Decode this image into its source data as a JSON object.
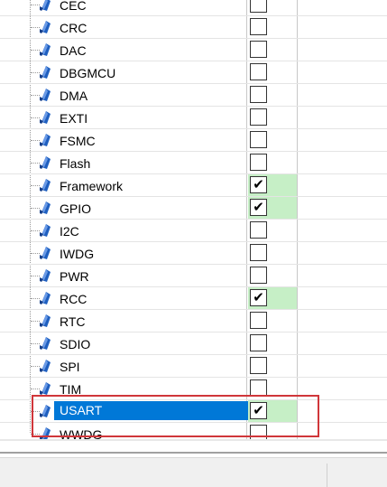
{
  "tree": {
    "items": [
      {
        "label": "CEC",
        "checked": false
      },
      {
        "label": "CRC",
        "checked": false
      },
      {
        "label": "DAC",
        "checked": false
      },
      {
        "label": "DBGMCU",
        "checked": false
      },
      {
        "label": "DMA",
        "checked": false
      },
      {
        "label": "EXTI",
        "checked": false
      },
      {
        "label": "FSMC",
        "checked": false
      },
      {
        "label": "Flash",
        "checked": false
      },
      {
        "label": "Framework",
        "checked": true
      },
      {
        "label": "GPIO",
        "checked": true
      },
      {
        "label": "I2C",
        "checked": false
      },
      {
        "label": "IWDG",
        "checked": false
      },
      {
        "label": "PWR",
        "checked": false
      },
      {
        "label": "RCC",
        "checked": true
      },
      {
        "label": "RTC",
        "checked": false
      },
      {
        "label": "SDIO",
        "checked": false
      },
      {
        "label": "SPI",
        "checked": false
      },
      {
        "label": "TIM",
        "checked": false
      },
      {
        "label": "USART",
        "checked": true,
        "selected": true
      },
      {
        "label": "WWDG",
        "checked": false
      }
    ],
    "check_mark": "✔",
    "item_icon": "blue-gem-icon"
  },
  "colors": {
    "selection": "#0078d7",
    "checked_cell": "#c6efc6",
    "highlight_border": "#d0363a",
    "icon_blue": "#1f5fbf"
  }
}
